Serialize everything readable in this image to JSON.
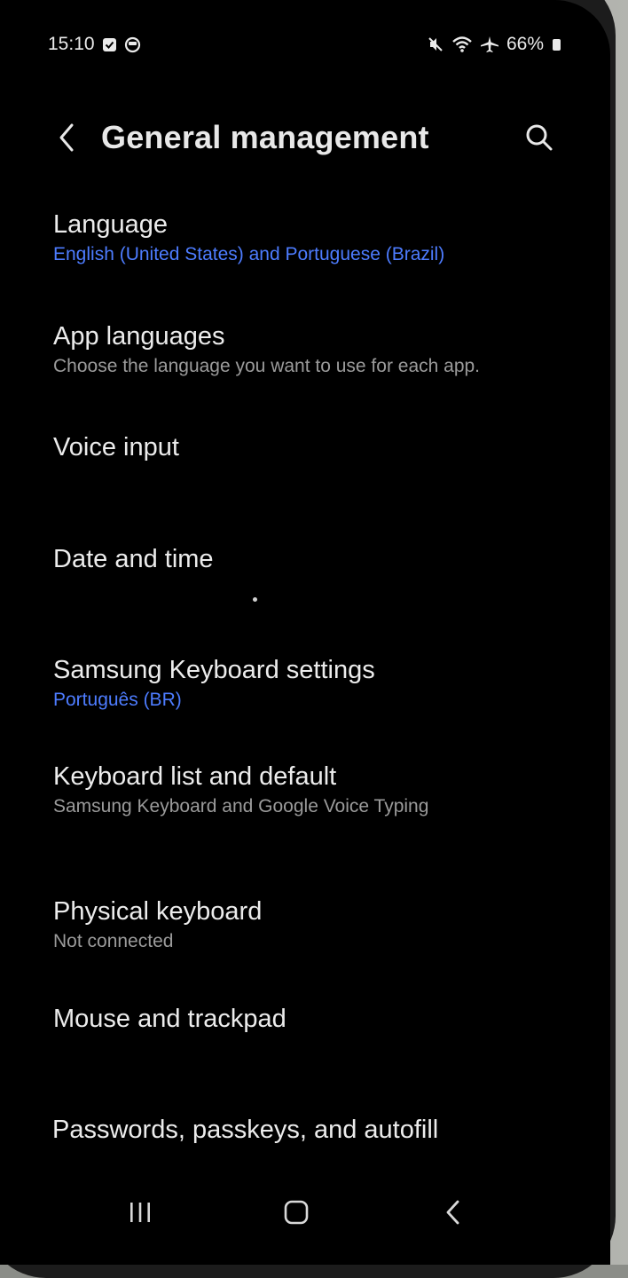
{
  "status_bar": {
    "time": "15:10",
    "left_icons": [
      "checkbox-icon",
      "messenger-icon"
    ],
    "right_icons": [
      "mute-icon",
      "wifi-icon",
      "airplane-icon",
      "battery-icon"
    ],
    "battery_percent": "66%"
  },
  "header": {
    "back_icon": "back-arrow-icon",
    "title": "General management",
    "search_icon": "search-icon"
  },
  "items": [
    {
      "title": "Language",
      "subtitle": "English (United States) and Portuguese (Brazil)",
      "subtitle_style": "accent"
    },
    {
      "title": "App languages",
      "subtitle": "Choose the language you want to use for each app.",
      "subtitle_style": "muted"
    },
    {
      "title": "Voice input",
      "subtitle": ""
    },
    {
      "title": "Date and time",
      "subtitle": ""
    },
    {
      "title": "Samsung Keyboard settings",
      "subtitle": "Português (BR)",
      "subtitle_style": "accent"
    },
    {
      "title": "Keyboard list and default",
      "subtitle": "Samsung Keyboard and Google Voice Typing",
      "subtitle_style": "muted"
    },
    {
      "title": "Physical keyboard",
      "subtitle": "Not connected",
      "subtitle_style": "muted"
    },
    {
      "title": "Mouse and trackpad",
      "subtitle": ""
    },
    {
      "title": "Passwords, passkeys, and autofill",
      "subtitle": ""
    }
  ],
  "nav_bar": {
    "recents_icon": "recents-icon",
    "home_icon": "home-icon",
    "back_icon": "back-icon"
  },
  "colors": {
    "background": "#000000",
    "text": "#ececec",
    "accent": "#4d7cff",
    "muted": "#9b9b9b"
  }
}
